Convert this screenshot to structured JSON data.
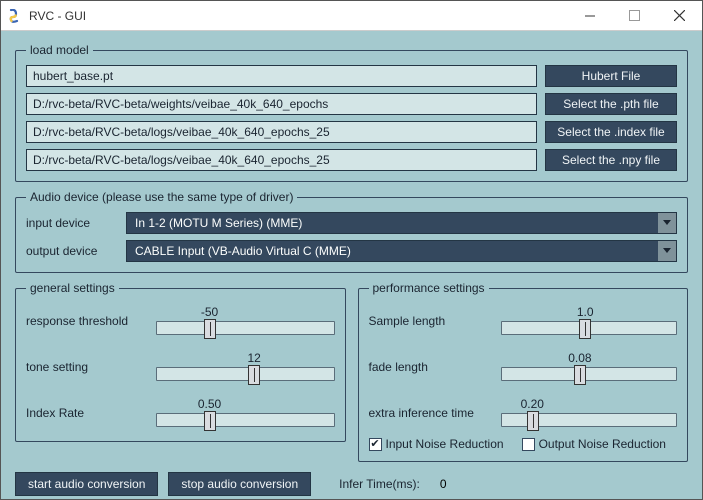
{
  "window": {
    "title": "RVC - GUI"
  },
  "loadModel": {
    "legend": "load model",
    "rows": [
      {
        "value": "hubert_base.pt",
        "button": "Hubert File"
      },
      {
        "value": "D:/rvc-beta/RVC-beta/weights/veibae_40k_640_epochs",
        "button": "Select the .pth file"
      },
      {
        "value": "D:/rvc-beta/RVC-beta/logs/veibae_40k_640_epochs_25",
        "button": "Select the .index file"
      },
      {
        "value": "D:/rvc-beta/RVC-beta/logs/veibae_40k_640_epochs_25",
        "button": "Select the .npy file"
      }
    ]
  },
  "audioDevice": {
    "legend": "Audio device (please use the same type of driver)",
    "inputLabel": "input device",
    "inputValue": "In 1-2 (MOTU M Series) (MME)",
    "outputLabel": "output device",
    "outputValue": "CABLE Input (VB-Audio Virtual C (MME)"
  },
  "general": {
    "legend": "general settings",
    "sliders": [
      {
        "label": "response threshold",
        "value": "-50",
        "pos": 30
      },
      {
        "label": "tone setting",
        "value": "12",
        "pos": 55
      },
      {
        "label": "Index Rate",
        "value": "0.50",
        "pos": 30
      }
    ]
  },
  "performance": {
    "legend": "performance settings",
    "sliders": [
      {
        "label": "Sample length",
        "value": "1.0",
        "pos": 48
      },
      {
        "label": "fade length",
        "value": "0.08",
        "pos": 45
      },
      {
        "label": "extra inference time",
        "value": "0.20",
        "pos": 18
      }
    ],
    "checks": [
      {
        "label": "Input Noise Reduction",
        "checked": true
      },
      {
        "label": "Output Noise Reduction",
        "checked": false
      }
    ]
  },
  "bottom": {
    "start": "start audio conversion",
    "stop": "stop audio conversion",
    "inferLabel": "Infer Time(ms):",
    "inferValue": "0"
  }
}
